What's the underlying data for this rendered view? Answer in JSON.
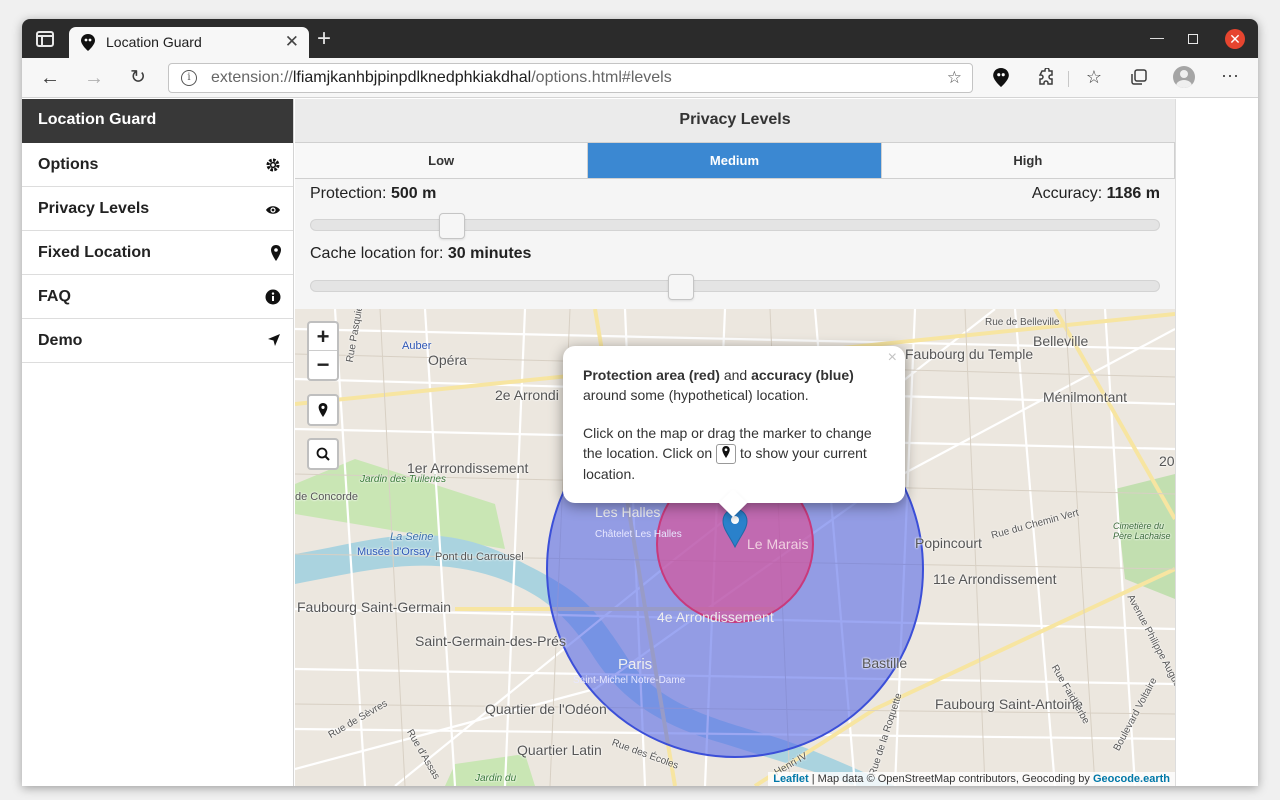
{
  "browser": {
    "tab_title": "Location Guard",
    "url_scheme": "extension://",
    "url_host": "lfiamjkanhbjpinpdlknedphkiakdhal",
    "url_path": "/options.html#levels"
  },
  "sidebar": {
    "title": "Location Guard",
    "items": [
      {
        "label": "Options",
        "icon": "gear-icon"
      },
      {
        "label": "Privacy Levels",
        "icon": "eye-icon"
      },
      {
        "label": "Fixed Location",
        "icon": "map-pin-icon"
      },
      {
        "label": "FAQ",
        "icon": "info-icon"
      },
      {
        "label": "Demo",
        "icon": "navigation-arrow-icon"
      }
    ]
  },
  "main": {
    "title": "Privacy Levels",
    "levels": [
      "Low",
      "Medium",
      "High"
    ],
    "selected_level": "Medium",
    "protection_label": "Protection:",
    "protection_value": "500 m",
    "accuracy_label": "Accuracy:",
    "accuracy_value": "1186 m",
    "cache_label": "Cache location for:",
    "cache_value": "30 minutes",
    "protection_slider_fraction": 0.167,
    "cache_slider_fraction": 0.436
  },
  "map": {
    "zoom_in": "+",
    "zoom_out": "−",
    "popup": {
      "bold1": "Protection area (red)",
      "and": "and",
      "bold2": "accuracy (blue)",
      "line1_rest": "around some (hypothetical) location.",
      "para2_a": "Click on the map or drag the marker to change the location. Click on",
      "para2_b": "to show your current location.",
      "close": "×"
    },
    "attribution": {
      "leaflet": "Leaflet",
      "mid": " | Map data © OpenStreetMap contributors, Geocoding by ",
      "geocode": "Geocode.earth"
    },
    "labels": [
      "Opéra",
      "2e Arrondi",
      "Auber",
      "1er Arrondissement",
      "Jardin des Tuileries",
      "La Seine",
      "Musée d'Orsay",
      "Pont du Carrousel",
      "Faubourg Saint-Germain",
      "Saint-Germain-des-Prés",
      "Les Halles",
      "Châtelet Les Halles",
      "Le Marais",
      "4e Arrondissement",
      "Paris",
      "Saint-Michel Notre-Dame",
      "Quartier de l'Odéon",
      "Quartier Latin",
      "Bastille",
      "Popincourt",
      "11e Arrondissement",
      "Faubourg Saint-Antoine",
      "Belleville",
      "Ménilmontant",
      "Faubourg du Temple",
      "Rue de Belleville",
      "Boulevard Voltaire",
      "Avenue Philippe Auguste",
      "Rue de Sèvres",
      "Rue d'Assas",
      "Rue des Écoles",
      "Rue du Chemin Vert",
      "Rue Faidherbe",
      "Rue de la Roquette",
      "Cimetière du Père Lachaise",
      "Jardin du",
      "Rue Pasquier",
      "de Concorde",
      "Henri IV",
      "20"
    ]
  },
  "colors": {
    "accent": "#3b88d2",
    "sidebar_header": "#383838",
    "protection": "#c84b8e",
    "accuracy": "#5a6fe0"
  }
}
